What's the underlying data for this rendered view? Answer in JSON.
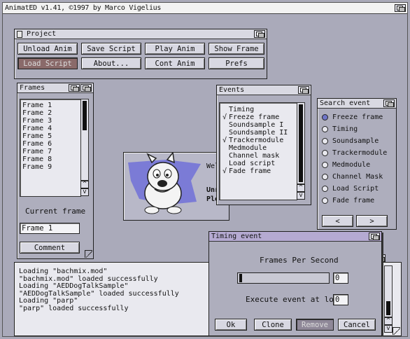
{
  "screen": {
    "title": "AnimatED v1.41, ©1997 by Marco Vigelius"
  },
  "project": {
    "title": "Project",
    "buttons": {
      "unload_anim": "Unload Anim",
      "save_script": "Save Script",
      "play_anim": "Play Anim",
      "show_frame": "Show Frame",
      "load_script": "Load Script",
      "about": "About...",
      "cont_anim": "Cont Anim",
      "prefs": "Prefs"
    }
  },
  "frames": {
    "title": "Frames",
    "items": [
      "Frame 1",
      "Frame 2",
      "Frame 3",
      "Frame 4",
      "Frame 5",
      "Frame 6",
      "Frame 7",
      "Frame 8",
      "Frame 9"
    ],
    "current_label": "Current frame",
    "current_value": "Frame 1",
    "comment_button": "Comment"
  },
  "preview": {
    "text_line1": "Wel",
    "text_line2": "Unr",
    "text_line3": "Ple"
  },
  "events": {
    "title": "Events",
    "items": [
      {
        "label": "Timing",
        "checked": false
      },
      {
        "label": "Freeze frame",
        "checked": true
      },
      {
        "label": "Soundsample I",
        "checked": false
      },
      {
        "label": "Soundsample II",
        "checked": false
      },
      {
        "label": "Trackermodule",
        "checked": true
      },
      {
        "label": "Medmodule",
        "checked": false
      },
      {
        "label": "Channel mask",
        "checked": false
      },
      {
        "label": "Load script",
        "checked": false
      },
      {
        "label": "Fade frame",
        "checked": true
      }
    ]
  },
  "search_event": {
    "title": "Search event",
    "options": [
      {
        "label": "Freeze frame",
        "selected": true
      },
      {
        "label": "Timing",
        "selected": false
      },
      {
        "label": "Soundsample",
        "selected": false
      },
      {
        "label": "Trackermodule",
        "selected": false
      },
      {
        "label": "Medmodule",
        "selected": false
      },
      {
        "label": "Channel Mask",
        "selected": false
      },
      {
        "label": "Load Script",
        "selected": false
      },
      {
        "label": "Fade frame",
        "selected": false
      }
    ],
    "prev": "<",
    "next": ">"
  },
  "log": {
    "lines": [
      "Loading \"bachmix.mod\"",
      "\"bachmix.mod\" loaded successfully",
      "Loading \"AEDDogTalkSample\"",
      "\"AEDDogTalkSample\" loaded successfully",
      "Loading \"parp\"",
      "\"parp\" loaded successfully"
    ]
  },
  "timing": {
    "title": "Timing event",
    "fps_label": "Frames Per Second",
    "fps_value": "0",
    "loop_label": "Execute event at loop",
    "loop_value": "0",
    "buttons": {
      "ok": "Ok",
      "clone": "Clone",
      "remove": "Remove",
      "cancel": "Cancel"
    }
  },
  "colors": {
    "desktop": "#aaaaba",
    "active_title": "#b5aad2",
    "radio_selected": "#6f75c8"
  }
}
